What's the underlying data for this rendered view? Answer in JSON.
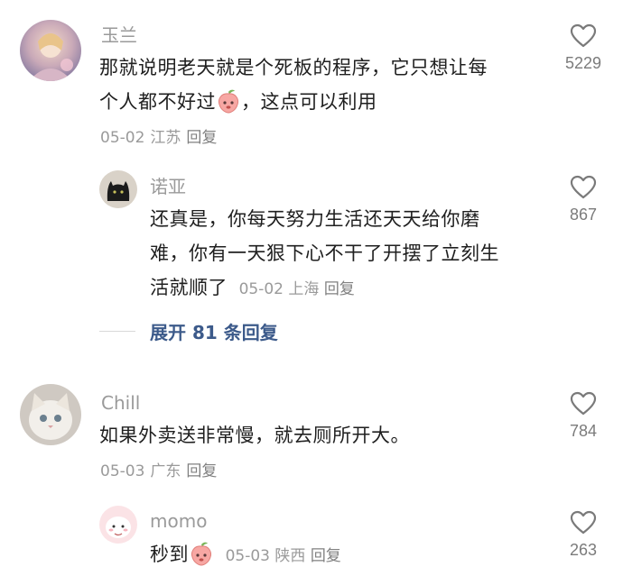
{
  "comments": [
    {
      "username": "玉兰",
      "text_a": "那就说明老天就是个死板的程序，它只想让每",
      "text_b": "个人都不好过",
      "text_c": "，这点可以利用",
      "date": "05-02",
      "location": "江苏",
      "reply_label": "回复",
      "likes": "5229",
      "emoji": "peach-face-emoji",
      "replies": [
        {
          "username": "诺亚",
          "text_a": "还真是，你每天努力生活还天天给你磨",
          "text_b": "难，你有一天狠下心不干了开摆了立刻生",
          "text_c": "活就顺了",
          "date": "05-02",
          "location": "上海",
          "reply_label": "回复",
          "likes": "867"
        }
      ],
      "expand_label": "展开 81 条回复"
    },
    {
      "username": "Chill",
      "text": "如果外卖送非常慢，就去厕所开大。",
      "date": "05-03",
      "location": "广东",
      "reply_label": "回复",
      "likes": "784",
      "replies": [
        {
          "username": "momo",
          "text": "秒到",
          "date": "05-03",
          "location": "陕西",
          "reply_label": "回复",
          "likes": "263",
          "emoji": "peach-face-emoji"
        }
      ]
    }
  ],
  "icons": {
    "like": "heart-outline-icon"
  },
  "colors": {
    "username": "#9a9a9a",
    "text": "#1f1f1f",
    "expand_link": "#3c5a8a"
  }
}
